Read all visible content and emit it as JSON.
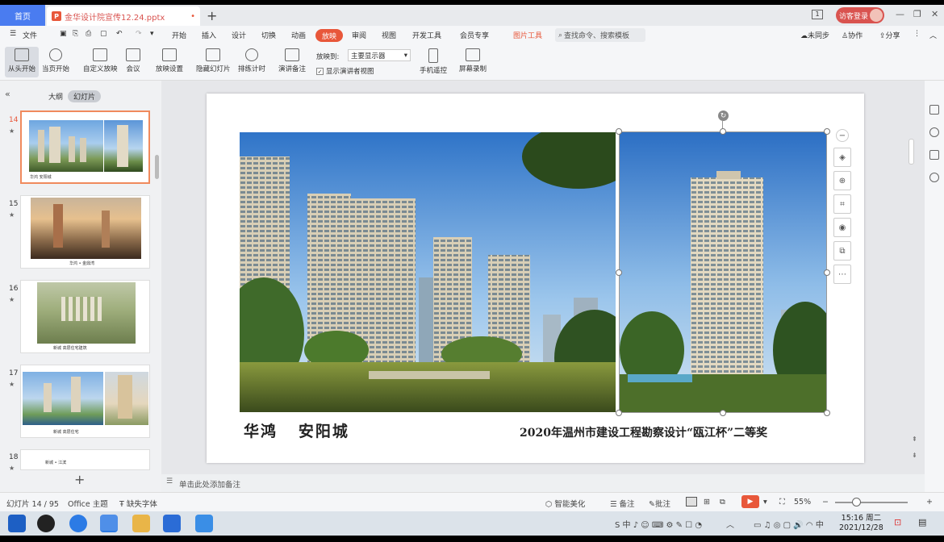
{
  "titlebar": {
    "home_tab": "首页",
    "doc_title": "金华设计院宣传12.24.pptx",
    "ppt_badge": "P",
    "login": "访客登录"
  },
  "menubar": {
    "file": "文件",
    "items": [
      "开始",
      "插入",
      "设计",
      "切换",
      "动画",
      "放映",
      "审阅",
      "视图",
      "开发工具",
      "会员专享",
      "图片工具"
    ],
    "search": "查找命令、搜索模板",
    "right": [
      "未同步",
      "协作",
      "分享"
    ]
  },
  "ribbon": {
    "buttons": [
      "从头开始",
      "当页开始",
      "自定义放映",
      "会议",
      "放映设置",
      "隐藏幻灯片",
      "排练计时",
      "演讲备注",
      "手机遥控",
      "屏幕录制"
    ],
    "play_to_label": "放映到:",
    "play_to_value": "主要显示器",
    "presenter_view": "显示演讲者视图"
  },
  "leftpane": {
    "tab_outline": "大纲",
    "tab_slides": "幻灯片",
    "thumbs": [
      {
        "num": "14",
        "caption": "华鸿 安阳城"
      },
      {
        "num": "15",
        "caption": "华鸿 • 金鼎湾"
      },
      {
        "num": "16",
        "caption": "新城 高层住宅建筑"
      },
      {
        "num": "17",
        "caption": "新城 高层住宅"
      },
      {
        "num": "18",
        "caption": "新城 • 江滨"
      }
    ]
  },
  "slide": {
    "caption_left": "华鸿   安阳城",
    "caption_right": "2020年温州市建设工程勘察设计“瓯江杯”二等奖"
  },
  "notes": {
    "placeholder": "单击此处添加备注"
  },
  "statusbar": {
    "slide_count": "幻灯片 14 / 95",
    "theme": "Office 主题",
    "missing_font": "缺失字体",
    "beautify": "智能美化",
    "notes": "备注",
    "comments": "批注",
    "zoom": "55%"
  },
  "taskbar": {
    "time": "15:16 周二",
    "date": "2021/12/28"
  },
  "colors": {
    "accent": "#e8573a",
    "home_blue": "#4a7cf0"
  }
}
